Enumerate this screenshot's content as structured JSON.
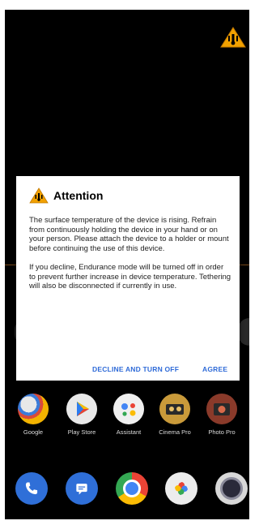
{
  "status": {
    "warning_icon": "thermometer-warning-icon"
  },
  "dialog": {
    "title": "Attention",
    "paragraph1": "The surface temperature of the device is rising. Refrain from continuously holding the device in your hand or on your person. Please attach the device to a holder or mount before continuing the use of this device.",
    "paragraph2": "If you decline, Endurance mode will be turned off in order to prevent further increase in device temperature. Tethering will also be disconnected if currently in use.",
    "decline_label": "DECLINE AND TURN OFF",
    "agree_label": "AGREE"
  },
  "apps": [
    {
      "label": "Google"
    },
    {
      "label": "Play Store"
    },
    {
      "label": "Assistant"
    },
    {
      "label": "Cinema Pro"
    },
    {
      "label": "Photo Pro"
    }
  ],
  "dock": [
    {
      "icon": "phone-icon"
    },
    {
      "icon": "messages-icon"
    },
    {
      "icon": "chrome-icon"
    },
    {
      "icon": "photos-icon"
    },
    {
      "icon": "camera-icon"
    }
  ],
  "colors": {
    "accent": "#2f6bd8",
    "warning": "#f2a100"
  }
}
